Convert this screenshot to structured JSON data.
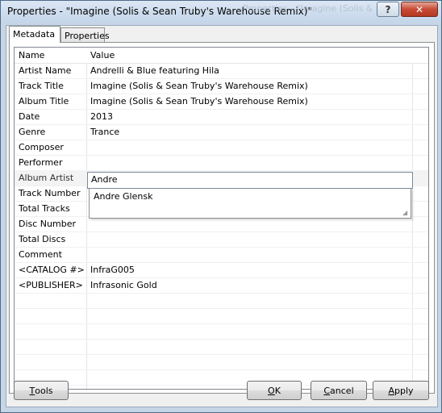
{
  "window": {
    "title": "Properties - \"Imagine (Solis & Sean Truby's Warehouse Remix)\"",
    "background_title": "Properties - \"Imagine (Solis & Sean Truby's Warehouse Remix)\"",
    "help_label": "?",
    "close_label": "✕"
  },
  "tabs": [
    {
      "label": "Metadata",
      "active": true
    },
    {
      "label": "Properties",
      "active": false
    }
  ],
  "grid": {
    "columns": [
      "Name",
      "Value"
    ],
    "rows": [
      {
        "name": "Artist Name",
        "value": "Andrelli & Blue featuring Hila"
      },
      {
        "name": "Track Title",
        "value": "Imagine (Solis & Sean Truby's Warehouse Remix)"
      },
      {
        "name": "Album Title",
        "value": "Imagine (Solis & Sean Truby's Warehouse Remix)"
      },
      {
        "name": "Date",
        "value": "2013"
      },
      {
        "name": "Genre",
        "value": "Trance"
      },
      {
        "name": "Composer",
        "value": ""
      },
      {
        "name": "Performer",
        "value": ""
      },
      {
        "name": "Album Artist",
        "value": ""
      },
      {
        "name": "Track Number",
        "value": ""
      },
      {
        "name": "Total Tracks",
        "value": ""
      },
      {
        "name": "Disc Number",
        "value": ""
      },
      {
        "name": "Total Discs",
        "value": ""
      },
      {
        "name": "Comment",
        "value": ""
      },
      {
        "name": "<CATALOG #>",
        "value": "InfraG005"
      },
      {
        "name": "<PUBLISHER>",
        "value": "Infrasonic Gold"
      }
    ],
    "edit_value": "Andre",
    "suggestions": [
      "Andre Glensk"
    ]
  },
  "buttons": {
    "tools": {
      "accel": "T",
      "rest": "ools"
    },
    "ok": {
      "accel": "O",
      "rest": "K"
    },
    "cancel": {
      "accel": "C",
      "rest": "ancel"
    },
    "apply": {
      "accel": "A",
      "rest": "pply"
    }
  }
}
